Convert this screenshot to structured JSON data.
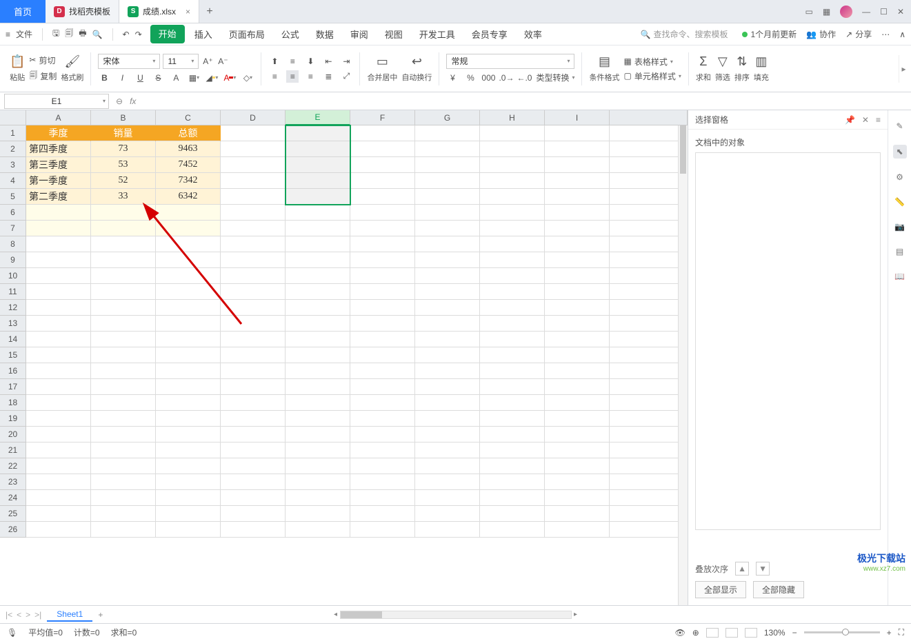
{
  "titlebar": {
    "homeTab": "首页",
    "tab1": "找稻壳模板",
    "tab2": "成绩.xlsx"
  },
  "menubar": {
    "file": "文件",
    "tabs": [
      "开始",
      "插入",
      "页面布局",
      "公式",
      "数据",
      "审阅",
      "视图",
      "开发工具",
      "会员专享",
      "效率"
    ],
    "searchPlaceholder": "查找命令、搜索模板",
    "update": "1个月前更新",
    "coop": "协作",
    "share": "分享"
  },
  "ribbon": {
    "paste": "粘贴",
    "cut": "剪切",
    "copy": "复制",
    "fmtPainter": "格式刷",
    "font": "宋体",
    "fontSize": "11",
    "mergeCenter": "合并居中",
    "autoWrap": "自动换行",
    "numFmt": "常规",
    "typeConv": "类型转换",
    "condFmt": "条件格式",
    "tableStyle": "表格样式",
    "cellStyle": "单元格样式",
    "sum": "求和",
    "filter": "筛选",
    "sort": "排序",
    "fill": "填充"
  },
  "formulaBar": {
    "name": "E1"
  },
  "grid": {
    "cols": [
      "A",
      "B",
      "C",
      "D",
      "E",
      "F",
      "G",
      "H",
      "I"
    ],
    "headerRow": [
      "季度",
      "销量",
      "总额"
    ],
    "data": [
      [
        "第四季度",
        "73",
        "9463"
      ],
      [
        "第三季度",
        "53",
        "7452"
      ],
      [
        "第一季度",
        "52",
        "7342"
      ],
      [
        "第二季度",
        "33",
        "6342"
      ]
    ],
    "rowsCount": 26
  },
  "panel": {
    "title": "选择窗格",
    "objects": "文档中的对象",
    "stackOrder": "叠放次序",
    "showAll": "全部显示",
    "hideAll": "全部隐藏"
  },
  "sheetTabs": {
    "sheet1": "Sheet1"
  },
  "statusbar": {
    "avg": "平均值=0",
    "count": "计数=0",
    "sum": "求和=0",
    "zoom": "130%"
  },
  "watermark": {
    "l1": "极光下载站",
    "l2": "www.xz7.com"
  }
}
